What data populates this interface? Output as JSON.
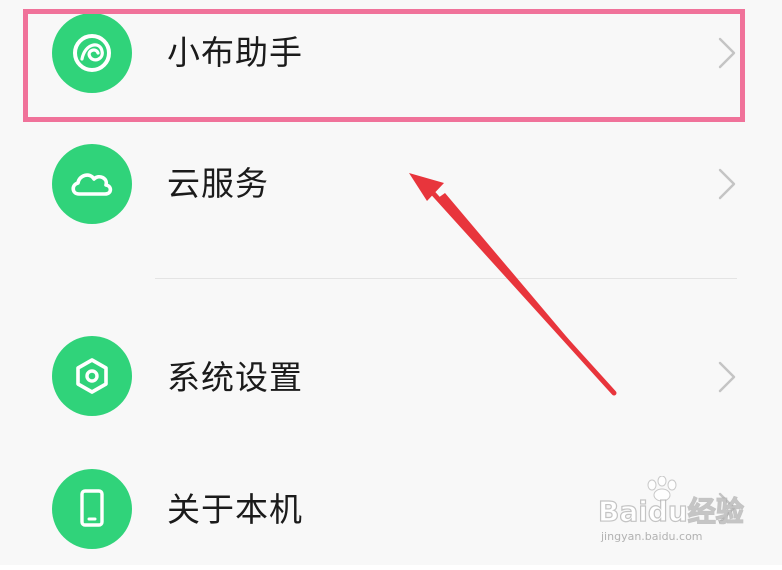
{
  "settings_list": {
    "items": [
      {
        "label": "小布助手",
        "icon": "assistant-icon"
      },
      {
        "label": "云服务",
        "icon": "cloud-icon"
      },
      {
        "label": "系统设置",
        "icon": "settings-hexagon-icon"
      },
      {
        "label": "关于本机",
        "icon": "phone-icon"
      }
    ]
  },
  "colors": {
    "icon_background": "#30d37a",
    "highlight_border": "#f0729a",
    "arrow": "#e8353c",
    "page_background": "#f8f8f8"
  },
  "watermark": {
    "brand": "Baidu经验",
    "url": "jingyan.baidu.com"
  }
}
